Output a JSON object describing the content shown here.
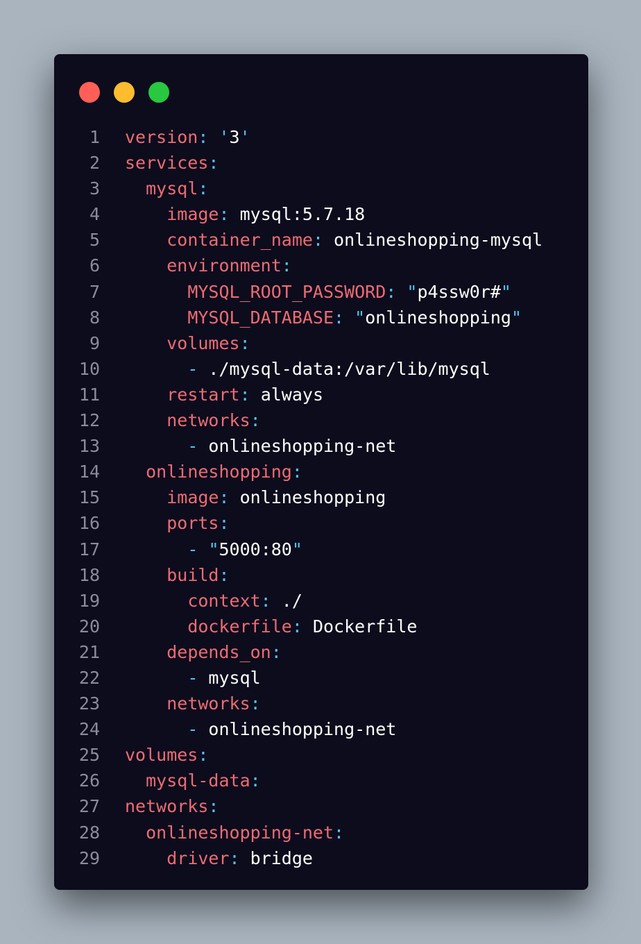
{
  "window": {
    "controls": {
      "close_color": "#ff5f57",
      "minimize_color": "#febc2e",
      "maximize_color": "#28c840"
    }
  },
  "colors": {
    "key": "#ee6b73",
    "punct": "#53c4f0",
    "value": "#ffffff",
    "line_number": "#8a8c99",
    "background": "#0c0c1d"
  },
  "code": {
    "lines": [
      {
        "n": "1",
        "indent": "",
        "dash": "",
        "key": "version",
        "colon": ":",
        "val": " ",
        "q1": "'",
        "str": "3",
        "q2": "'"
      },
      {
        "n": "2",
        "indent": "",
        "dash": "",
        "key": "services",
        "colon": ":",
        "val": "",
        "q1": "",
        "str": "",
        "q2": ""
      },
      {
        "n": "3",
        "indent": "  ",
        "dash": "",
        "key": "mysql",
        "colon": ":",
        "val": "",
        "q1": "",
        "str": "",
        "q2": ""
      },
      {
        "n": "4",
        "indent": "    ",
        "dash": "",
        "key": "image",
        "colon": ":",
        "val": " mysql:5.7.18",
        "q1": "",
        "str": "",
        "q2": ""
      },
      {
        "n": "5",
        "indent": "    ",
        "dash": "",
        "key": "container_name",
        "colon": ":",
        "val": " onlineshopping-mysql",
        "q1": "",
        "str": "",
        "q2": ""
      },
      {
        "n": "6",
        "indent": "    ",
        "dash": "",
        "key": "environment",
        "colon": ":",
        "val": "",
        "q1": "",
        "str": "",
        "q2": ""
      },
      {
        "n": "7",
        "indent": "      ",
        "dash": "",
        "key": "MYSQL_ROOT_PASSWORD",
        "colon": ":",
        "val": " ",
        "q1": "\"",
        "str": "p4ssw0r#",
        "q2": "\""
      },
      {
        "n": "8",
        "indent": "      ",
        "dash": "",
        "key": "MYSQL_DATABASE",
        "colon": ":",
        "val": " ",
        "q1": "\"",
        "str": "onlineshopping",
        "q2": "\""
      },
      {
        "n": "9",
        "indent": "    ",
        "dash": "",
        "key": "volumes",
        "colon": ":",
        "val": "",
        "q1": "",
        "str": "",
        "q2": ""
      },
      {
        "n": "10",
        "indent": "      ",
        "dash": "-",
        "key": "",
        "colon": "",
        "val": " ./mysql-data:/var/lib/mysql",
        "q1": "",
        "str": "",
        "q2": ""
      },
      {
        "n": "11",
        "indent": "    ",
        "dash": "",
        "key": "restart",
        "colon": ":",
        "val": " always",
        "q1": "",
        "str": "",
        "q2": ""
      },
      {
        "n": "12",
        "indent": "    ",
        "dash": "",
        "key": "networks",
        "colon": ":",
        "val": "",
        "q1": "",
        "str": "",
        "q2": ""
      },
      {
        "n": "13",
        "indent": "      ",
        "dash": "-",
        "key": "",
        "colon": "",
        "val": " onlineshopping-net",
        "q1": "",
        "str": "",
        "q2": ""
      },
      {
        "n": "14",
        "indent": "  ",
        "dash": "",
        "key": "onlineshopping",
        "colon": ":",
        "val": "",
        "q1": "",
        "str": "",
        "q2": ""
      },
      {
        "n": "15",
        "indent": "    ",
        "dash": "",
        "key": "image",
        "colon": ":",
        "val": " onlineshopping",
        "q1": "",
        "str": "",
        "q2": ""
      },
      {
        "n": "16",
        "indent": "    ",
        "dash": "",
        "key": "ports",
        "colon": ":",
        "val": "",
        "q1": "",
        "str": "",
        "q2": ""
      },
      {
        "n": "17",
        "indent": "      ",
        "dash": "-",
        "key": "",
        "colon": "",
        "val": " ",
        "q1": "\"",
        "str": "5000:80",
        "q2": "\""
      },
      {
        "n": "18",
        "indent": "    ",
        "dash": "",
        "key": "build",
        "colon": ":",
        "val": "",
        "q1": "",
        "str": "",
        "q2": ""
      },
      {
        "n": "19",
        "indent": "      ",
        "dash": "",
        "key": "context",
        "colon": ":",
        "val": " ./",
        "q1": "",
        "str": "",
        "q2": ""
      },
      {
        "n": "20",
        "indent": "      ",
        "dash": "",
        "key": "dockerfile",
        "colon": ":",
        "val": " Dockerfile",
        "q1": "",
        "str": "",
        "q2": ""
      },
      {
        "n": "21",
        "indent": "    ",
        "dash": "",
        "key": "depends_on",
        "colon": ":",
        "val": "",
        "q1": "",
        "str": "",
        "q2": ""
      },
      {
        "n": "22",
        "indent": "      ",
        "dash": "-",
        "key": "",
        "colon": "",
        "val": " mysql",
        "q1": "",
        "str": "",
        "q2": ""
      },
      {
        "n": "23",
        "indent": "    ",
        "dash": "",
        "key": "networks",
        "colon": ":",
        "val": "",
        "q1": "",
        "str": "",
        "q2": ""
      },
      {
        "n": "24",
        "indent": "      ",
        "dash": "-",
        "key": "",
        "colon": "",
        "val": " onlineshopping-net",
        "q1": "",
        "str": "",
        "q2": ""
      },
      {
        "n": "25",
        "indent": "",
        "dash": "",
        "key": "volumes",
        "colon": ":",
        "val": "",
        "q1": "",
        "str": "",
        "q2": ""
      },
      {
        "n": "26",
        "indent": "  ",
        "dash": "",
        "key": "mysql-data",
        "colon": ":",
        "val": "",
        "q1": "",
        "str": "",
        "q2": ""
      },
      {
        "n": "27",
        "indent": "",
        "dash": "",
        "key": "networks",
        "colon": ":",
        "val": "",
        "q1": "",
        "str": "",
        "q2": ""
      },
      {
        "n": "28",
        "indent": "  ",
        "dash": "",
        "key": "onlineshopping-net",
        "colon": ":",
        "val": "",
        "q1": "",
        "str": "",
        "q2": ""
      },
      {
        "n": "29",
        "indent": "    ",
        "dash": "",
        "key": "driver",
        "colon": ":",
        "val": " bridge",
        "q1": "",
        "str": "",
        "q2": ""
      }
    ]
  }
}
